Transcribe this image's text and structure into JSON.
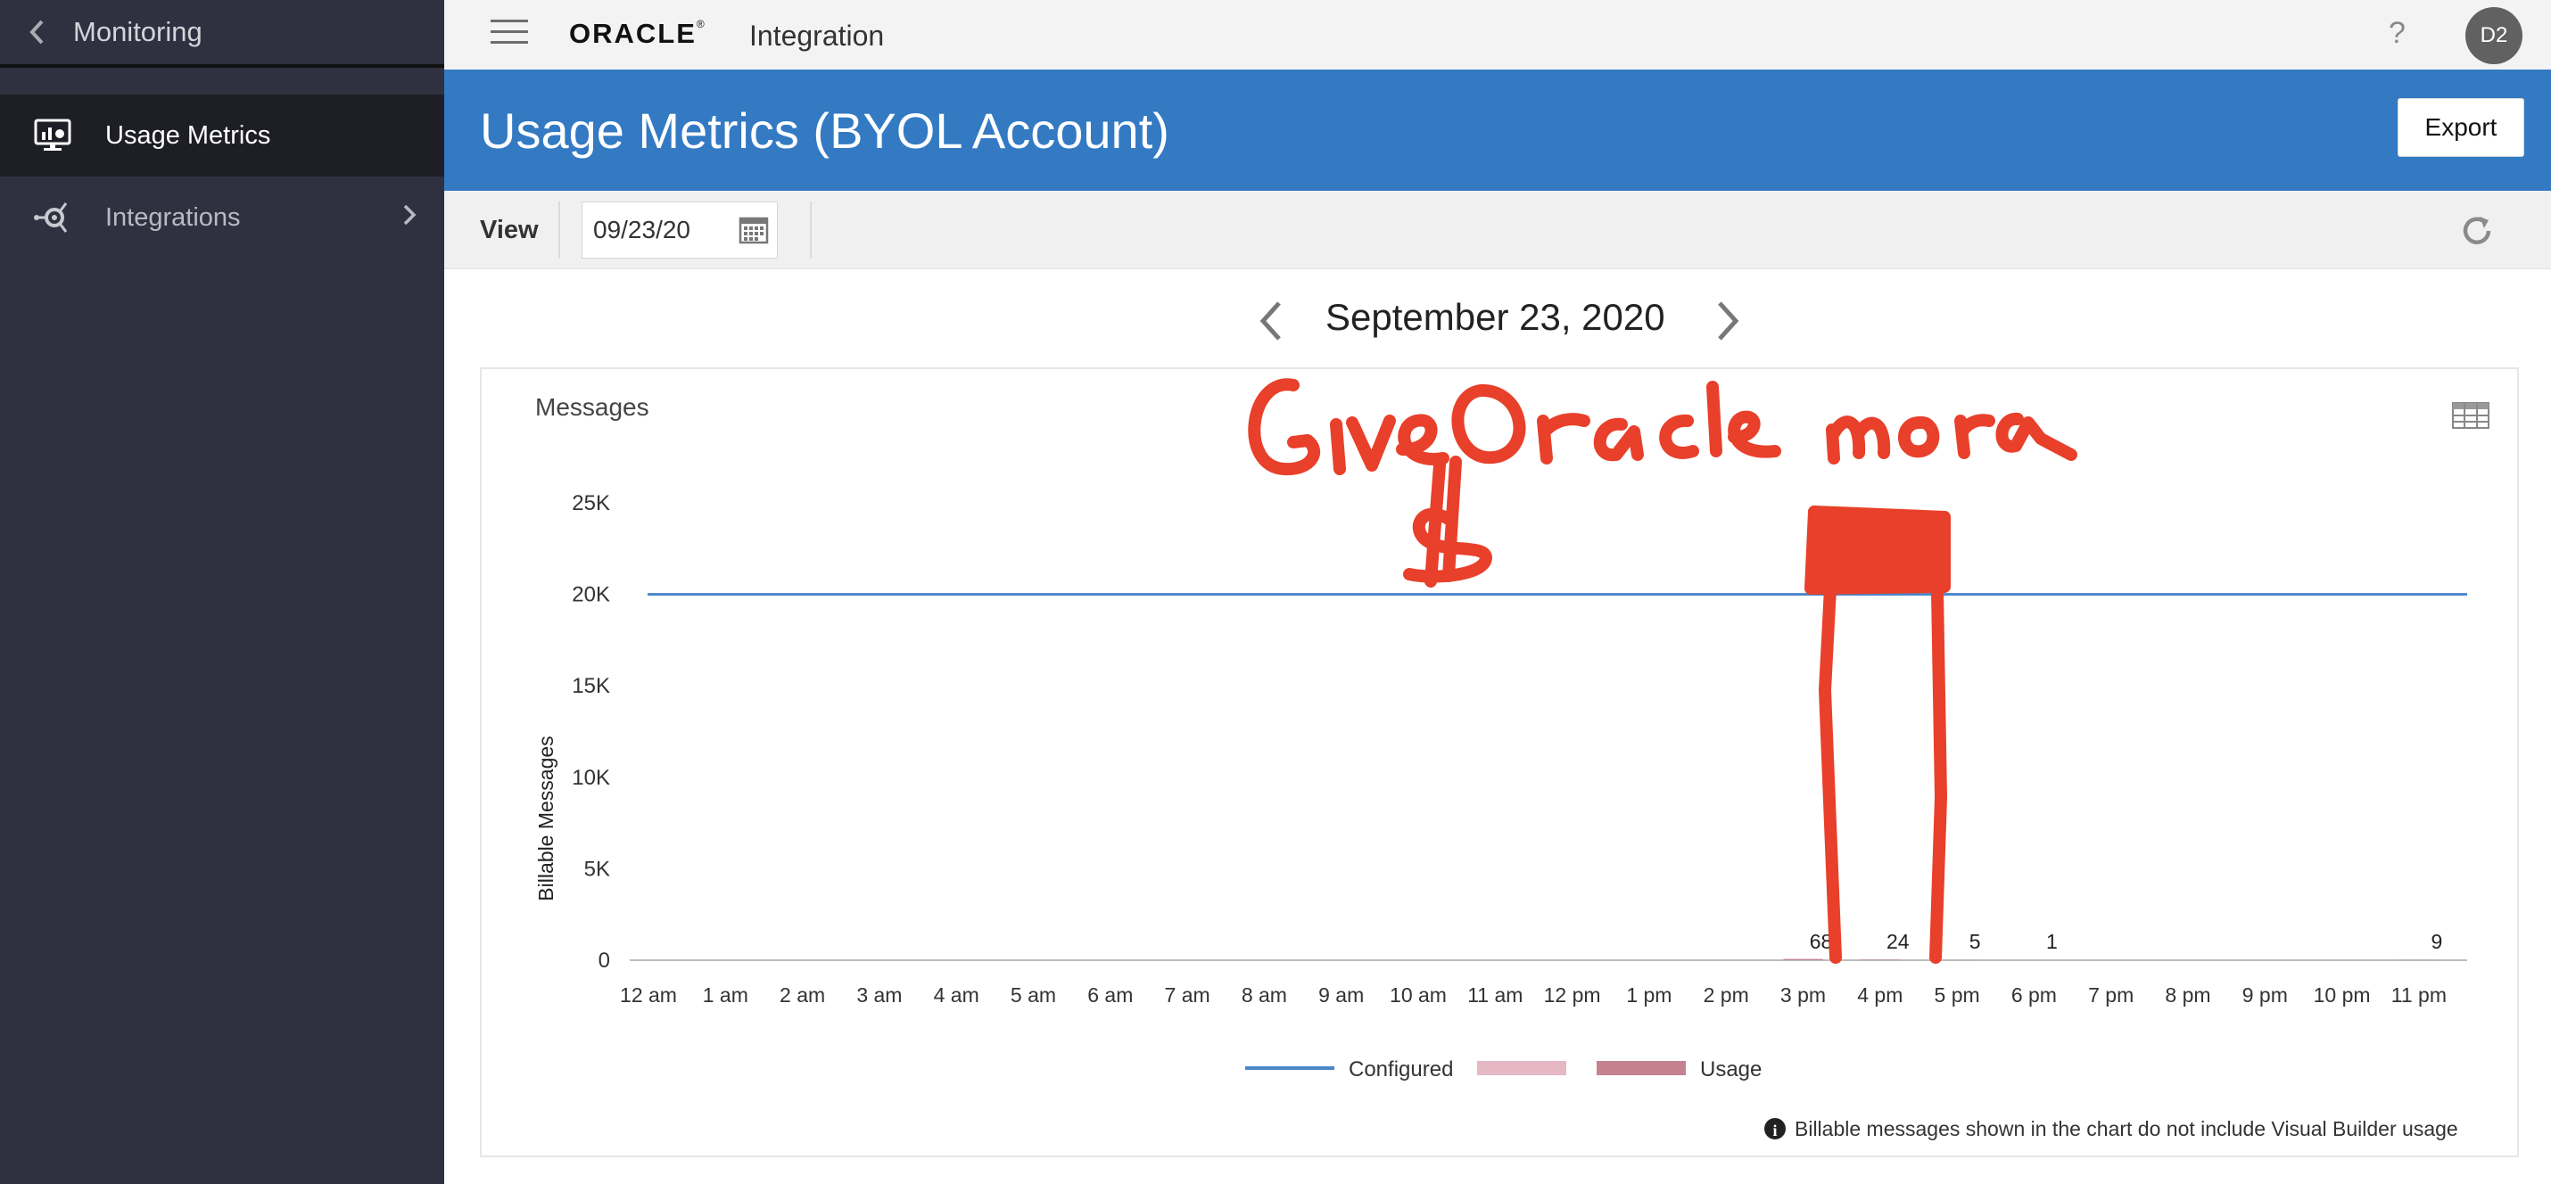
{
  "sidebar": {
    "title": "Monitoring",
    "items": [
      {
        "label": "Usage Metrics",
        "icon": "monitor-chart-icon"
      },
      {
        "label": "Integrations",
        "icon": "integrations-icon"
      }
    ]
  },
  "topbar": {
    "brand": "ORACLE",
    "product": "Integration",
    "help": "?",
    "avatar": "D2"
  },
  "header": {
    "title": "Usage Metrics (BYOL Account)",
    "export_label": "Export"
  },
  "toolbar": {
    "view_label": "View",
    "date_value": "09/23/20"
  },
  "main": {
    "date_title": "September 23, 2020",
    "info_note": "Billable messages shown in the chart do not include Visual Builder usage"
  },
  "annotation": {
    "text": "Give Oracle more $"
  },
  "colors": {
    "sidebar": "#2f3140",
    "header": "#337ac3",
    "configured_line": "#4a86c8",
    "usage_light": "#e6b8c4",
    "usage": "#c4828f",
    "annotation": "#e8402a"
  },
  "chart_data": {
    "type": "bar",
    "title": "Messages",
    "ylabel": "Billable Messages",
    "xlabel": "",
    "ylim": [
      0,
      25000
    ],
    "yticks": [
      "0",
      "5K",
      "10K",
      "15K",
      "20K",
      "25K"
    ],
    "categories": [
      "12 am",
      "1 am",
      "2 am",
      "3 am",
      "4 am",
      "5 am",
      "6 am",
      "7 am",
      "8 am",
      "9 am",
      "10 am",
      "11 am",
      "12 pm",
      "1 pm",
      "2 pm",
      "3 pm",
      "4 pm",
      "5 pm",
      "6 pm",
      "7 pm",
      "8 pm",
      "9 pm",
      "10 pm",
      "11 pm"
    ],
    "series": [
      {
        "name": "Configured",
        "kind": "line",
        "values": [
          20000,
          20000,
          20000,
          20000,
          20000,
          20000,
          20000,
          20000,
          20000,
          20000,
          20000,
          20000,
          20000,
          20000,
          20000,
          20000,
          20000,
          20000,
          20000,
          20000,
          20000,
          20000,
          20000,
          20000
        ]
      },
      {
        "name": "Usage",
        "kind": "bar",
        "values": [
          0,
          0,
          0,
          0,
          0,
          0,
          0,
          0,
          0,
          0,
          0,
          0,
          0,
          0,
          0,
          68,
          24,
          5,
          1,
          0,
          0,
          0,
          0,
          9
        ]
      }
    ],
    "data_labels": [
      {
        "category": "3 pm",
        "text": "68"
      },
      {
        "category": "4 pm",
        "text": "24"
      },
      {
        "category": "5 pm",
        "text": "5"
      },
      {
        "category": "6 pm",
        "text": "1"
      },
      {
        "category": "11 pm",
        "text": "9"
      }
    ],
    "legend": [
      "Configured",
      "",
      "Usage"
    ],
    "legend_position": "bottom",
    "grid": false
  }
}
